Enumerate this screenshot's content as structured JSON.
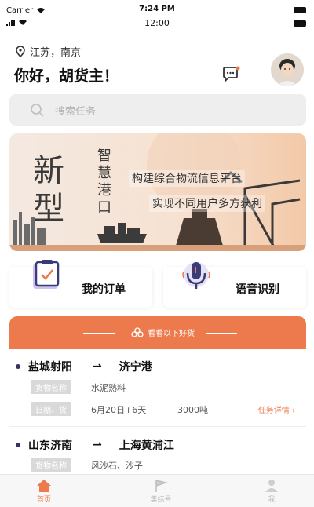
{
  "status": {
    "carrier": "Carrier",
    "time_top": "7:24 PM",
    "time_bottom": "12:00"
  },
  "header": {
    "location": "江苏，南京",
    "greeting": "你好，胡货主！"
  },
  "search": {
    "placeholder": "搜索任务"
  },
  "banner": {
    "title": "新型",
    "subtitle_vertical": "智慧港口",
    "line1": "构建综合物流信息平台",
    "line2": "实现不同用户多方获利"
  },
  "actions": [
    {
      "label": "我的订单"
    },
    {
      "label": "语音识别"
    }
  ],
  "goods_header": {
    "label": "看看以下好货"
  },
  "tasks": [
    {
      "from": "盐城射阳",
      "to": "济宁港",
      "tag1": "货物名称",
      "goods": "水泥熟料",
      "tag2": "日期、货",
      "date": "6月20日+6天",
      "weight": "3000吨",
      "detail": "任务详情 ›"
    },
    {
      "from": "山东济南",
      "to": "上海黄浦江",
      "tag1": "货物名称",
      "goods": "风沙石、沙子"
    }
  ],
  "tabbar": [
    {
      "label": "首页"
    },
    {
      "label": "集结号"
    },
    {
      "label": "我"
    }
  ],
  "colors": {
    "accent": "#ec7a4c",
    "banner": "#f6e2d2"
  }
}
